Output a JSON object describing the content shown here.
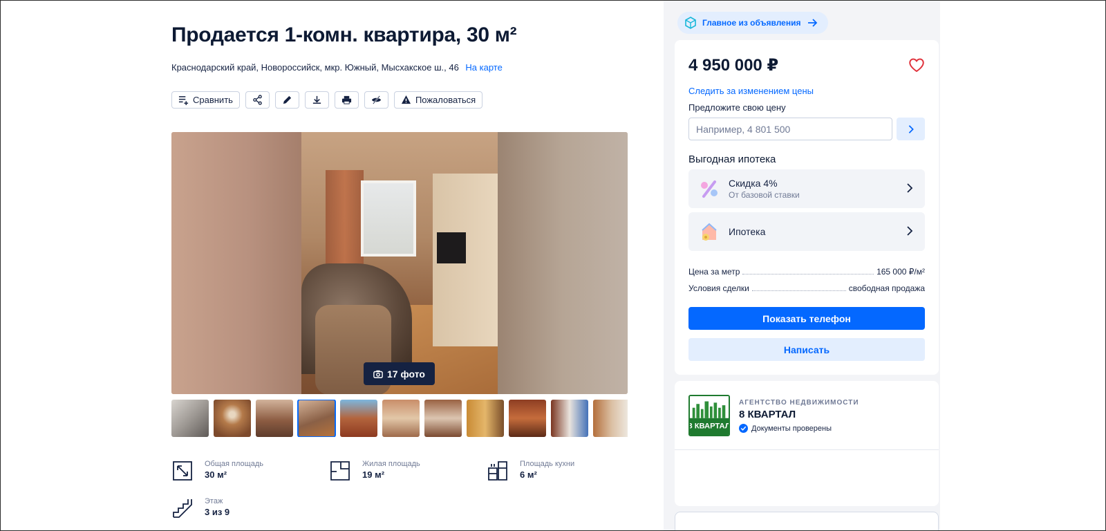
{
  "listing": {
    "title": "Продается 1-комн. квартира, 30 м²",
    "address": "Краснодарский край, Новороссийск, мкр. Южный, Мысхакское ш., 46",
    "map_link": "На карте"
  },
  "toolbar": {
    "compare_label": "Сравнить",
    "report_label": "Пожаловаться"
  },
  "gallery": {
    "photo_count_label": "17 фото",
    "active_thumb_index": 3,
    "visible_thumbs": 11
  },
  "params": {
    "total_area": {
      "label": "Общая площадь",
      "value": "30 м²"
    },
    "living_area": {
      "label": "Жилая площадь",
      "value": "19 м²"
    },
    "kitchen_area": {
      "label": "Площадь кухни",
      "value": "6 м²"
    },
    "floor": {
      "label": "Этаж",
      "value": "3 из 9"
    }
  },
  "sidebar": {
    "promo_label": "Главное из объявления",
    "price": "4 950 000 ₽",
    "watch_price_link": "Следить за изменением цены",
    "offer_label": "Предложите свою цену",
    "offer_placeholder": "Например, 4 801 500",
    "mortgage_title": "Выгодная ипотека",
    "mortgage_items": [
      {
        "title": "Скидка 4%",
        "subtitle": "От базовой ставки"
      },
      {
        "title": "Ипотека",
        "subtitle": ""
      }
    ],
    "price_per_meter": {
      "label": "Цена за метр",
      "value": "165 000 ₽/м²"
    },
    "deal_terms": {
      "label": "Условия сделки",
      "value": "свободная продажа"
    },
    "show_phone_label": "Показать телефон",
    "write_label": "Написать",
    "accent_color": "#0468ff"
  },
  "agent": {
    "type": "АГЕНТСТВО НЕДВИЖИМОСТИ",
    "name": "8 КВАРТАЛ",
    "verified": "Документы проверены",
    "logo_text": "8 КВАРТАЛ"
  }
}
